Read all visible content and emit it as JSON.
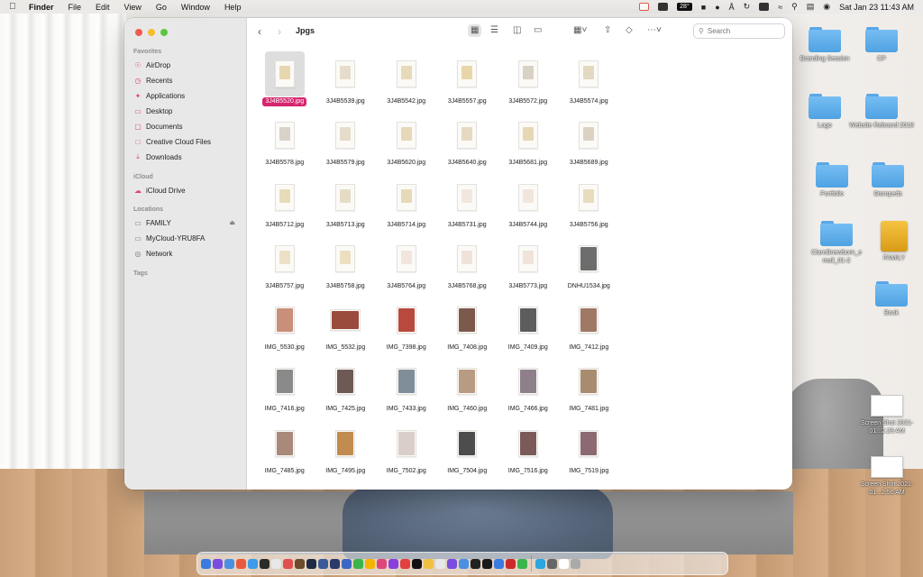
{
  "menubar": {
    "apple": "",
    "items": [
      "Finder",
      "File",
      "Edit",
      "View",
      "Go",
      "Window",
      "Help"
    ],
    "status": {
      "temp": "28°",
      "clock": "Sat Jan 23  11:43 AM"
    }
  },
  "window": {
    "title": "Jpgs",
    "back_icon": "chevron-left-icon",
    "forward_icon": "chevron-right-icon",
    "search_placeholder": "Search"
  },
  "sidebar": {
    "sections": [
      {
        "header": "Favorites",
        "items": [
          {
            "label": "AirDrop",
            "icon": "airdrop-icon"
          },
          {
            "label": "Recents",
            "icon": "clock-icon"
          },
          {
            "label": "Applications",
            "icon": "applications-icon"
          },
          {
            "label": "Desktop",
            "icon": "desktop-icon"
          },
          {
            "label": "Documents",
            "icon": "document-icon"
          },
          {
            "label": "Creative Cloud Files",
            "icon": "folder-icon"
          },
          {
            "label": "Downloads",
            "icon": "download-icon"
          }
        ]
      },
      {
        "header": "iCloud",
        "items": [
          {
            "label": "iCloud Drive",
            "icon": "cloud-icon"
          }
        ]
      },
      {
        "header": "Locations",
        "items": [
          {
            "label": "FAMILY",
            "icon": "drive-icon"
          },
          {
            "label": "MyCloud-YRU8FA",
            "icon": "display-icon"
          },
          {
            "label": "Network",
            "icon": "globe-icon"
          }
        ]
      },
      {
        "header": "Tags",
        "items": []
      }
    ]
  },
  "files": [
    {
      "name": "3J4B5520.jpg",
      "kind": "portrait",
      "color": "#e7d7ae",
      "selected": true
    },
    {
      "name": "3J4B5539.jpg",
      "kind": "portrait",
      "color": "#e6dccb"
    },
    {
      "name": "3J4B5542.jpg",
      "kind": "portrait",
      "color": "#e7dab9"
    },
    {
      "name": "3J4B5557.jpg",
      "kind": "portrait",
      "color": "#e8d6aa"
    },
    {
      "name": "3J4B5572.jpg",
      "kind": "portrait",
      "color": "#d9d1c4"
    },
    {
      "name": "3J4B5574.jpg",
      "kind": "portrait",
      "color": "#e3d8c0"
    },
    {
      "name": "3J4B5578.jpg",
      "kind": "portrait",
      "color": "#d9d2c8"
    },
    {
      "name": "3J4B5579.jpg",
      "kind": "portrait",
      "color": "#e5dccb"
    },
    {
      "name": "3J4B5620.jpg",
      "kind": "portrait",
      "color": "#e6d8b8"
    },
    {
      "name": "3J4B5640.jpg",
      "kind": "portrait",
      "color": "#e5d9c2"
    },
    {
      "name": "3J4B5681.jpg",
      "kind": "portrait",
      "color": "#e7d8b5"
    },
    {
      "name": "3J4B5689.jpg",
      "kind": "portrait",
      "color": "#dcd2c4"
    },
    {
      "name": "3J4B5712.jpg",
      "kind": "portrait",
      "color": "#e8dbb9"
    },
    {
      "name": "3J4B5713.jpg",
      "kind": "portrait",
      "color": "#e6dcc6"
    },
    {
      "name": "3J4B5714.jpg",
      "kind": "portrait",
      "color": "#e6d9b7"
    },
    {
      "name": "3J4B5731.jpg",
      "kind": "portrait",
      "color": "#f0e7df"
    },
    {
      "name": "3J4B5744.jpg",
      "kind": "portrait",
      "color": "#f1e6dc"
    },
    {
      "name": "3J4B5756.jpg",
      "kind": "portrait",
      "color": "#e8dcbe"
    },
    {
      "name": "3J4B5757.jpg",
      "kind": "portrait",
      "color": "#ece1c6"
    },
    {
      "name": "3J4B5758.jpg",
      "kind": "portrait",
      "color": "#ebdfc0"
    },
    {
      "name": "3J4B5764.jpg",
      "kind": "portrait",
      "color": "#f1e5dc"
    },
    {
      "name": "3J4B5768.jpg",
      "kind": "portrait",
      "color": "#efe3da"
    },
    {
      "name": "3J4B5773.jpg",
      "kind": "portrait",
      "color": "#f0e4da"
    },
    {
      "name": "DNHU1534.jpg",
      "kind": "portrait",
      "color": "#6d6d6d",
      "dark": true
    },
    {
      "name": "IMG_5530.jpg",
      "kind": "portrait",
      "color": "#c98f7a",
      "dark": true
    },
    {
      "name": "IMG_5532.jpg",
      "kind": "landscape",
      "color": "#9a4b3c",
      "dark": true
    },
    {
      "name": "IMG_7398.jpg",
      "kind": "portrait",
      "color": "#b84a3d",
      "dark": true
    },
    {
      "name": "IMG_7408.jpg",
      "kind": "portrait",
      "color": "#7b5a4c",
      "dark": true
    },
    {
      "name": "IMG_7409.jpg",
      "kind": "portrait",
      "color": "#5d5d5d",
      "dark": true
    },
    {
      "name": "IMG_7412.jpg",
      "kind": "portrait",
      "color": "#a07866",
      "dark": true
    },
    {
      "name": "IMG_7416.jpg",
      "kind": "portrait",
      "color": "#8a8a8a",
      "dark": true
    },
    {
      "name": "IMG_7425.jpg",
      "kind": "portrait",
      "color": "#6e5a55",
      "dark": true
    },
    {
      "name": "IMG_7433.jpg",
      "kind": "portrait",
      "color": "#7f8e99",
      "dark": true
    },
    {
      "name": "IMG_7460.jpg",
      "kind": "portrait",
      "color": "#b89b83",
      "dark": true
    },
    {
      "name": "IMG_7466.jpg",
      "kind": "portrait",
      "color": "#8e7f8a",
      "dark": true
    },
    {
      "name": "IMG_7481.jpg",
      "kind": "portrait",
      "color": "#a88c70",
      "dark": true
    },
    {
      "name": "IMG_7485.jpg",
      "kind": "portrait",
      "color": "#a8897a",
      "dark": true
    },
    {
      "name": "IMG_7495.jpg",
      "kind": "portrait",
      "color": "#c28b4f",
      "dark": true
    },
    {
      "name": "IMG_7502.jpg",
      "kind": "portrait",
      "color": "#d9cfc8",
      "dark": true
    },
    {
      "name": "IMG_7504.jpg",
      "kind": "portrait",
      "color": "#4d4d4d",
      "dark": true
    },
    {
      "name": "IMG_7516.jpg",
      "kind": "portrait",
      "color": "#7b5b58",
      "dark": true
    },
    {
      "name": "IMG_7519.jpg",
      "kind": "portrait",
      "color": "#8c6a72",
      "dark": true
    }
  ],
  "desktop_icons": [
    {
      "label": "Branding Session",
      "type": "folder"
    },
    {
      "label": "CP",
      "type": "folder"
    },
    {
      "label": "Logo",
      "type": "folder"
    },
    {
      "label": "Website Rebrand 2018",
      "type": "folder"
    },
    {
      "label": "Portfolio",
      "type": "folder"
    },
    {
      "label": "Stompeds",
      "type": "folder"
    },
    {
      "label": "ClareBnewborn_e mail_01-2",
      "type": "folder"
    },
    {
      "label": "FAMILY",
      "type": "drive"
    },
    {
      "label": "Book",
      "type": "folder"
    },
    {
      "label": "Screen Shot 2021-01...2.23 AM",
      "type": "screenshot"
    },
    {
      "label": "Screen Shot 2021-01...2.56 AM",
      "type": "screenshot"
    }
  ],
  "dock_colors": [
    "#3b7be0",
    "#7b4ce0",
    "#4a90e2",
    "#e85a3c",
    "#3d9be9",
    "#2b2b2b",
    "#e7e7e7",
    "#e05050",
    "#6b4b2b",
    "#1f2a44",
    "#3a5a9a",
    "#2b3a6a",
    "#3c66c4",
    "#3bb54a",
    "#f4b400",
    "#e0457a",
    "#8a3ee0",
    "#e04040",
    "#111111",
    "#f0c040",
    "#e8e8e8",
    "#7b4ce0",
    "#4a90e2",
    "#222222",
    "#1a1a1a",
    "#3b7be0",
    "#cc2b2b",
    "#3bb54a",
    "#2aa6e0",
    "#666666",
    "#ffffff",
    "#aaaaaa"
  ]
}
